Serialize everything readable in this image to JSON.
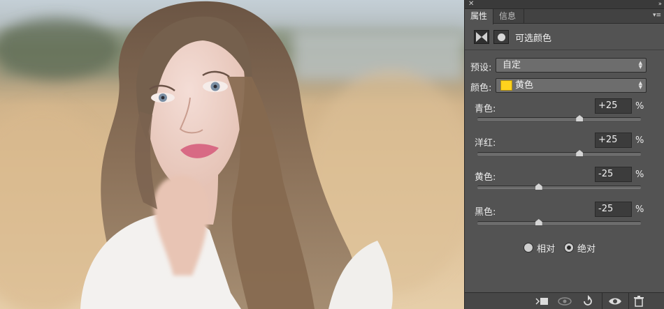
{
  "panel": {
    "close_glyph": "✕",
    "collapse_glyph": "››",
    "tabs": [
      {
        "label": "属性",
        "active": true
      },
      {
        "label": "信息",
        "active": false
      }
    ],
    "menu_glyph": "▾≡",
    "layer_title": "可选颜色",
    "preset": {
      "label": "预设:",
      "value": "自定"
    },
    "color": {
      "label": "颜色:",
      "value": "黄色",
      "swatch": "#FFD21D"
    },
    "sliders": [
      {
        "label": "青色:",
        "value": "+25",
        "unit": "%",
        "position_pct": 25
      },
      {
        "label": "洋红:",
        "value": "+25",
        "unit": "%",
        "position_pct": 25
      },
      {
        "label": "黄色:",
        "value": "-25",
        "unit": "%",
        "position_pct": -25
      },
      {
        "label": "黑色:",
        "value": "-25",
        "unit": "%",
        "position_pct": -25
      }
    ],
    "method": {
      "options": [
        "相对",
        "绝对"
      ],
      "selected": "绝对"
    },
    "bottom_icons": [
      "clip-to-layer-icon",
      "view-previous-state-icon",
      "reset-icon",
      "visibility-eye-icon",
      "trash-icon"
    ]
  },
  "colors": {
    "panel_bg": "#535353",
    "accent_swatch": "#FFD21D"
  }
}
